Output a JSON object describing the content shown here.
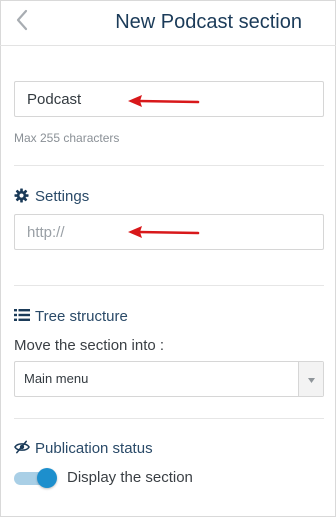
{
  "header": {
    "title": "New Podcast section",
    "back_icon": "chevron-left-icon"
  },
  "name_field": {
    "value": "Podcast",
    "hint": "Max 255 characters"
  },
  "settings": {
    "heading": "Settings",
    "icon": "gear-icon",
    "url_placeholder": "http://"
  },
  "tree": {
    "heading": "Tree structure",
    "icon": "list-icon",
    "move_label": "Move the section into :",
    "selected": "Main menu"
  },
  "publication": {
    "heading": "Publication status",
    "icon": "eye-slash-icon",
    "toggle_label": "Display the section",
    "toggle_on": true
  },
  "colors": {
    "title": "#1b3b59",
    "toggle_knob": "#1d8fcd",
    "annotation_arrow": "#d8181a"
  }
}
